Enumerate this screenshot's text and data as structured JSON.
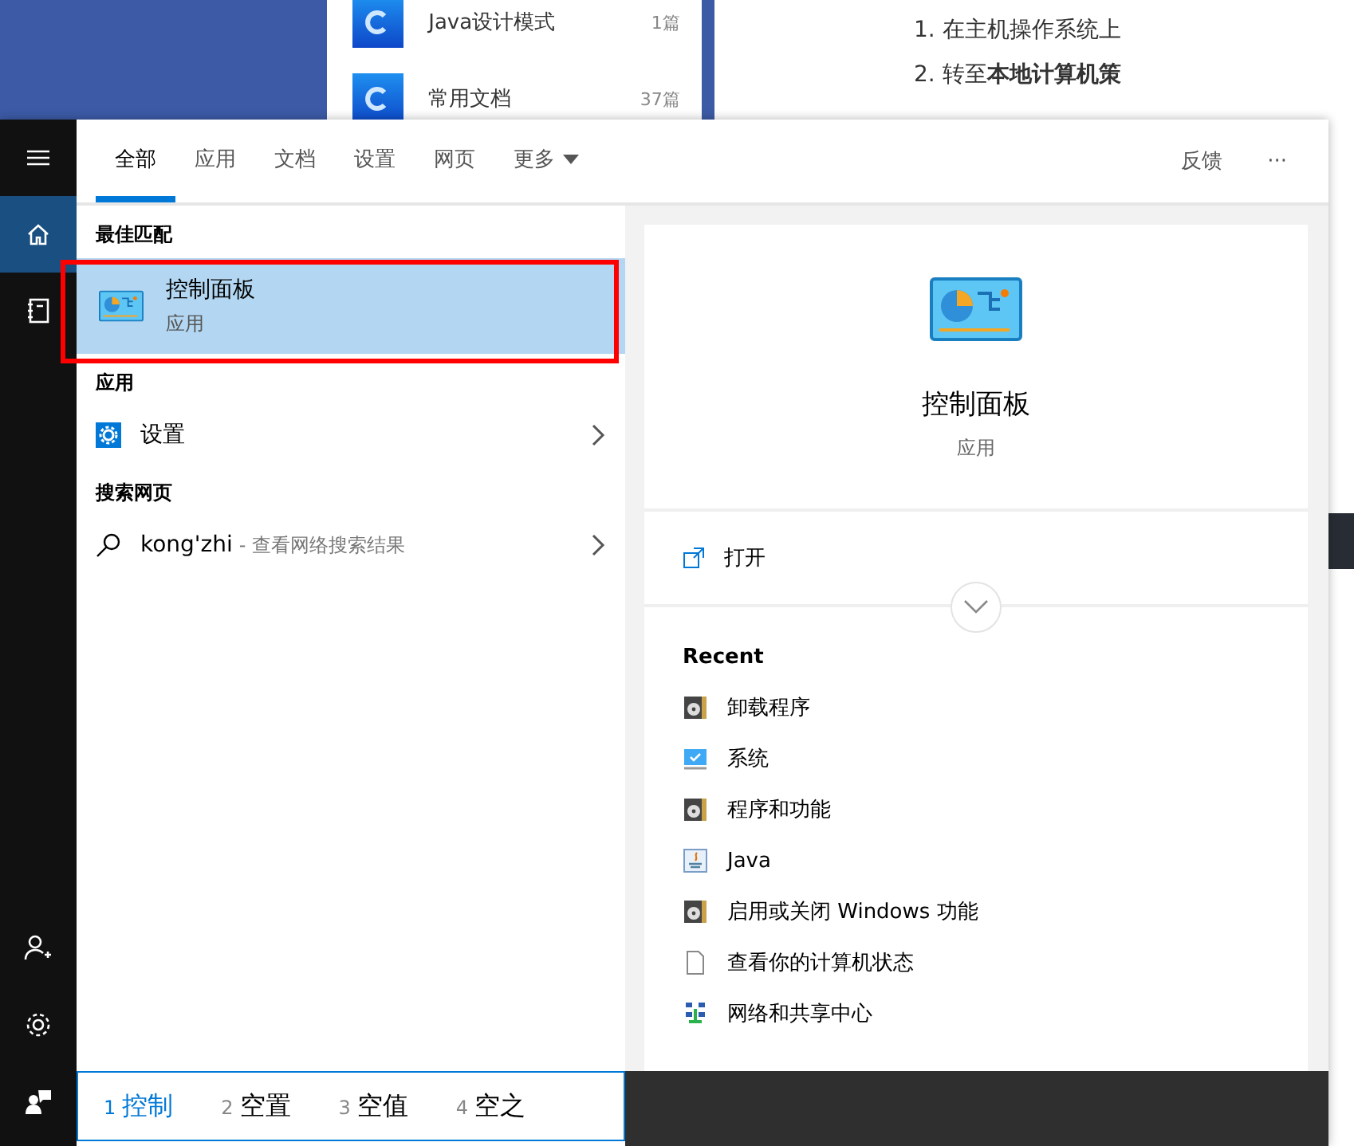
{
  "background": {
    "blog_list": [
      {
        "title": "Java设计模式",
        "count": "1篇"
      },
      {
        "title": "常用文档",
        "count": "37篇"
      }
    ],
    "article": {
      "lines": [
        "1. 在主机操作系统上",
        "2. 转至**本地计算机策**"
      ]
    }
  },
  "rail": {
    "top": [
      {
        "kind": "menu",
        "selected": false
      },
      {
        "kind": "home",
        "selected": true
      },
      {
        "kind": "notebook",
        "selected": false
      }
    ],
    "bottom": [
      {
        "kind": "user-add",
        "selected": false
      },
      {
        "kind": "settings",
        "selected": false
      },
      {
        "kind": "feedback",
        "selected": false
      }
    ]
  },
  "tabs": [
    {
      "label": "全部",
      "selected": true
    },
    {
      "label": "应用",
      "selected": false
    },
    {
      "label": "文档",
      "selected": false
    },
    {
      "label": "设置",
      "selected": false
    },
    {
      "label": "网页",
      "selected": false
    },
    {
      "label": "更多",
      "selected": false,
      "dropdown": true
    }
  ],
  "header_actions": {
    "feedback": "反馈",
    "more": "···"
  },
  "best_match": {
    "heading": "最佳匹配",
    "title": "控制面板",
    "subtitle": "应用",
    "selected": true,
    "outlined": true
  },
  "apps": {
    "heading": "应用",
    "items": [
      {
        "label": "设置"
      }
    ]
  },
  "web": {
    "heading": "搜索网页",
    "items": [
      {
        "query": "kong'zhi",
        "hint": "- 查看网络搜索结果"
      }
    ]
  },
  "preview": {
    "title": "控制面板",
    "subtitle": "应用",
    "actions": [
      {
        "label": "打开"
      }
    ],
    "recent_heading": "Recent",
    "recent": [
      {
        "kind": "installer",
        "label": "卸载程序"
      },
      {
        "kind": "monitor",
        "label": "系统"
      },
      {
        "kind": "installer",
        "label": "程序和功能"
      },
      {
        "kind": "java",
        "label": "Java"
      },
      {
        "kind": "installer",
        "label": "启用或关闭 Windows 功能"
      },
      {
        "kind": "document",
        "label": "查看你的计算机状态"
      },
      {
        "kind": "network",
        "label": "网络和共享中心"
      }
    ]
  },
  "ime": {
    "candidates": [
      {
        "index": "1",
        "text": "控制",
        "selected": true
      },
      {
        "index": "2",
        "text": "空置",
        "selected": false
      },
      {
        "index": "3",
        "text": "空值",
        "selected": false
      },
      {
        "index": "4",
        "text": "空之",
        "selected": false
      }
    ]
  }
}
